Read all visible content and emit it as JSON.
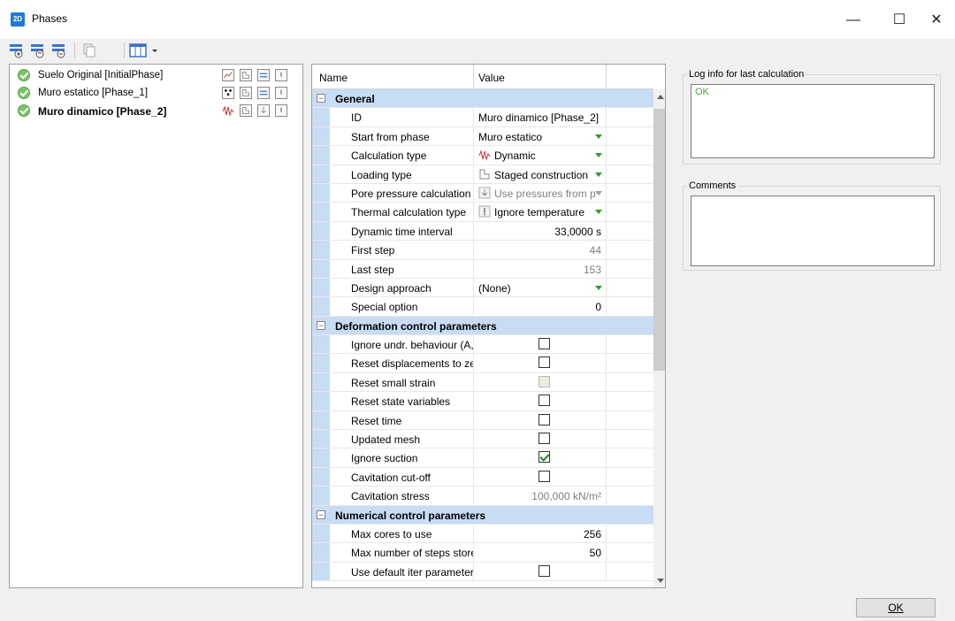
{
  "window": {
    "title": "Phases",
    "app_icon": "2D",
    "minimize": "—",
    "maximize": "☐",
    "close": "✕"
  },
  "toolbar": {
    "icons": [
      "insert-phase-icon",
      "add-phase-icon",
      "delete-phase-icon",
      "copy-icon",
      "columns-dropdown-icon"
    ]
  },
  "phases": [
    {
      "label": "Suelo Original [InitialPhase]",
      "status": "ok",
      "bold": false
    },
    {
      "label": "Muro estatico [Phase_1]",
      "status": "ok",
      "bold": false
    },
    {
      "label": "Muro dinamico [Phase_2]",
      "status": "ok",
      "bold": true
    }
  ],
  "grid": {
    "header_name": "Name",
    "header_value": "Value",
    "sections": {
      "general": "General",
      "deformation": "Deformation control parameters",
      "numerical": "Numerical control parameters"
    },
    "general": [
      {
        "name": "ID",
        "value": "Muro dinamico [Phase_2]"
      },
      {
        "name": "Start from phase",
        "value": "Muro estatico"
      },
      {
        "name": "Calculation type",
        "value": "Dynamic"
      },
      {
        "name": "Loading type",
        "value": "Staged construction"
      },
      {
        "name": "Pore pressure calculation ty",
        "value": "Use pressures from p"
      },
      {
        "name": "Thermal calculation type",
        "value": "Ignore temperature"
      },
      {
        "name": "Dynamic time interval",
        "value": "33,0000 s"
      },
      {
        "name": "First step",
        "value": "44"
      },
      {
        "name": "Last step",
        "value": "153"
      },
      {
        "name": "Design approach",
        "value": "(None)"
      },
      {
        "name": "Special option",
        "value": "0"
      }
    ],
    "deformation": [
      {
        "name": "Ignore undr. behaviour (A,",
        "checked": false,
        "disabled": false
      },
      {
        "name": "Reset displacements to zer",
        "checked": false,
        "disabled": false
      },
      {
        "name": "Reset small strain",
        "checked": false,
        "disabled": true
      },
      {
        "name": "Reset state variables",
        "checked": false,
        "disabled": false
      },
      {
        "name": "Reset time",
        "checked": false,
        "disabled": false
      },
      {
        "name": "Updated mesh",
        "checked": false,
        "disabled": false
      },
      {
        "name": "Ignore suction",
        "checked": true,
        "disabled": false
      },
      {
        "name": "Cavitation cut-off",
        "checked": false,
        "disabled": false
      },
      {
        "name": "Cavitation stress",
        "value": "100,000 kN/m²"
      }
    ],
    "numerical": [
      {
        "name": "Max cores to use",
        "value": "256"
      },
      {
        "name": "Max number of steps store",
        "value": "50"
      },
      {
        "name": "Use default iter parameters",
        "checked": false
      }
    ]
  },
  "right": {
    "log_title": "Log info for last calculation",
    "log_text": "OK",
    "comments_title": "Comments",
    "comments_text": ""
  },
  "ok_button": "OK",
  "colors": {
    "section_bg": "#c8dcf4",
    "ok_green": "#4fa83d",
    "check_green": "#7cc36a"
  }
}
